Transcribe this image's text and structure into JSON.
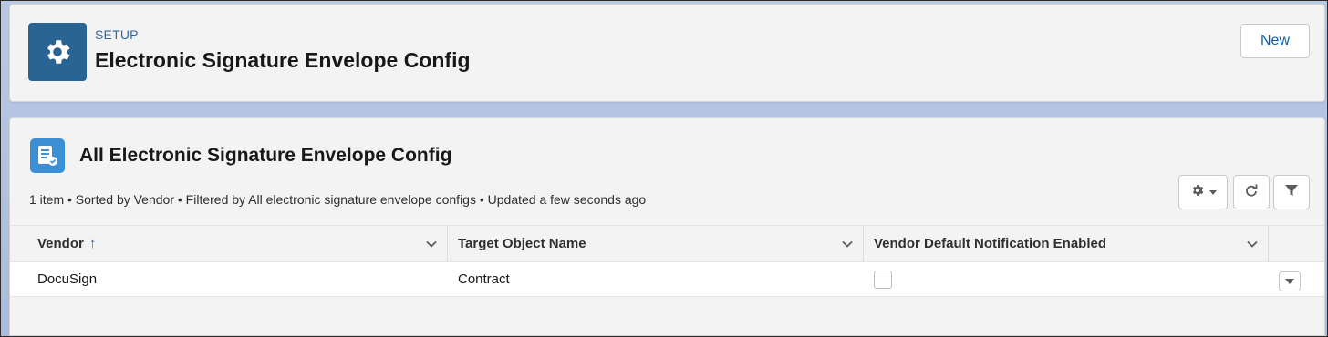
{
  "header": {
    "eyebrow": "SETUP",
    "title": "Electronic Signature Envelope Config",
    "new_button": "New",
    "icon": "gear-icon"
  },
  "list_view": {
    "icon": "list-view-icon",
    "title": "All Electronic Signature Envelope Config",
    "meta": "1 item • Sorted by Vendor • Filtered by All electronic signature envelope configs • Updated a few seconds ago",
    "toolbar": {
      "settings_icon": "gear-dropdown-icon",
      "refresh_icon": "refresh-icon",
      "filter_icon": "filter-icon"
    },
    "columns": [
      {
        "label": "Vendor",
        "sort_indicator": "↑"
      },
      {
        "label": "Target Object Name"
      },
      {
        "label": "Vendor Default Notification Enabled"
      }
    ],
    "rows": [
      {
        "vendor": "DocuSign",
        "target_object_name": "Contract",
        "vendor_default_notification_enabled": false
      }
    ]
  },
  "colors": {
    "brand_blue": "#0b5cab",
    "setup_icon_bg": "#2a6494",
    "list_icon_bg": "#3b8fd4"
  }
}
